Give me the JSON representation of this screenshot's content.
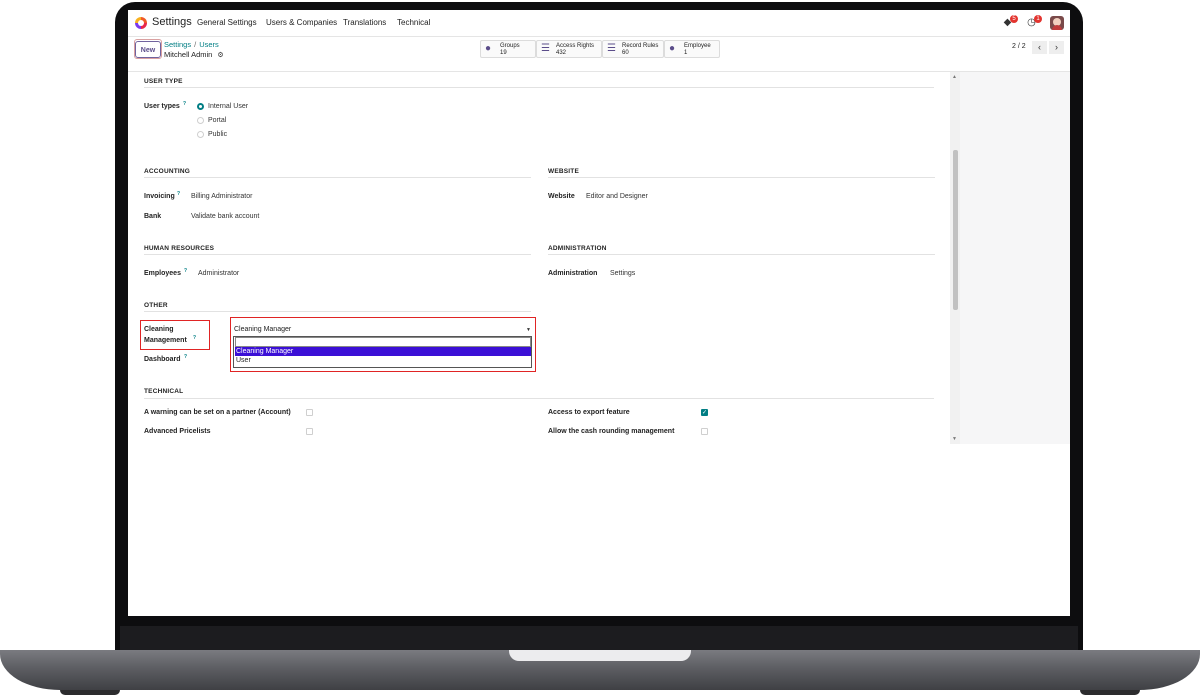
{
  "navbar": {
    "app_name": "Settings",
    "menu": [
      "General Settings",
      "Users & Companies",
      "Translations",
      "Technical"
    ],
    "chat_badge": "5",
    "activity_badge": "1"
  },
  "control": {
    "new_label": "New",
    "breadcrumb": [
      "Settings",
      "Users"
    ],
    "record_name": "Mitchell Admin",
    "stats": [
      {
        "label": "Groups",
        "count": "19"
      },
      {
        "label": "Access Rights",
        "count": "432"
      },
      {
        "label": "Record Rules",
        "count": "60"
      },
      {
        "label": "Employee",
        "count": "1"
      }
    ],
    "pager": "2 / 2"
  },
  "user_type": {
    "title": "USER TYPE",
    "label": "User types",
    "options": [
      {
        "label": "Internal User",
        "selected": true
      },
      {
        "label": "Portal",
        "selected": false
      },
      {
        "label": "Public",
        "selected": false
      }
    ]
  },
  "accounting": {
    "title": "ACCOUNTING",
    "invoicing_label": "Invoicing",
    "invoicing_value": "Billing Administrator",
    "bank_label": "Bank",
    "bank_value": "Validate bank account"
  },
  "website": {
    "title": "WEBSITE",
    "label": "Website",
    "value": "Editor and Designer"
  },
  "human_resources": {
    "title": "HUMAN RESOURCES",
    "label": "Employees",
    "value": "Administrator"
  },
  "administration": {
    "title": "ADMINISTRATION",
    "label": "Administration",
    "value": "Settings"
  },
  "other": {
    "title": "OTHER",
    "cleaning_label_1": "Cleaning",
    "cleaning_label_2": "Management",
    "dashboard_label": "Dashboard",
    "select_value": "Cleaning Manager",
    "dropdown_options": [
      "Cleaning Manager",
      "User"
    ],
    "highlight_color": "#e02424",
    "selected_option_color": "#3b0fd6"
  },
  "technical": {
    "title": "TECHNICAL",
    "items": [
      {
        "label": "A warning can be set on a partner (Account)",
        "checked": false
      },
      {
        "label": "Access to export feature",
        "checked": true
      },
      {
        "label": "Advanced Pricelists",
        "checked": false
      },
      {
        "label": "Allow the cash rounding management",
        "checked": false
      }
    ]
  },
  "help_mark": "?",
  "colors": {
    "accent": "#017e84",
    "brand": "#71639e"
  }
}
